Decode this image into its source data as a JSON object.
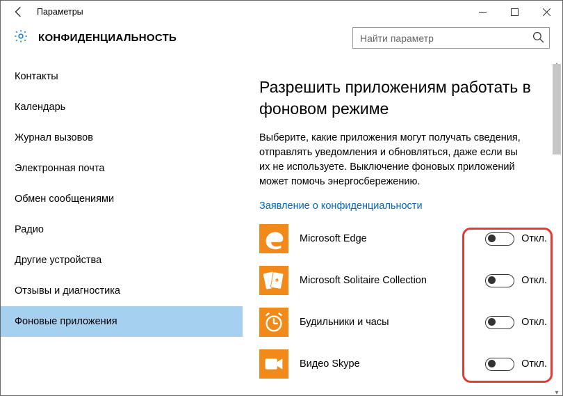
{
  "titlebar": {
    "back": "←",
    "title": "Параметры"
  },
  "header": {
    "title": "КОНФИДЕНЦИАЛЬНОСТЬ",
    "search_placeholder": "Найти параметр"
  },
  "sidebar": {
    "items": [
      {
        "label": "Контакты"
      },
      {
        "label": "Календарь"
      },
      {
        "label": "Журнал вызовов"
      },
      {
        "label": "Электронная почта"
      },
      {
        "label": "Обмен сообщениями"
      },
      {
        "label": "Радио"
      },
      {
        "label": "Другие устройства"
      },
      {
        "label": "Отзывы и диагностика"
      },
      {
        "label": "Фоновые приложения",
        "selected": true
      }
    ]
  },
  "main": {
    "title": "Разрешить приложениям работать в фоновом режиме",
    "description": "Выберите, какие приложения могут получать сведения, отправлять уведомления и обновляться, даже если вы их не используете. Выключение фоновых приложений может помочь энергосбережению.",
    "privacy_link": "Заявление о конфиденциальности",
    "apps": [
      {
        "name": "Microsoft Edge",
        "state": "Откл.",
        "icon": "edge"
      },
      {
        "name": "Microsoft Solitaire Collection",
        "state": "Откл.",
        "icon": "solitaire"
      },
      {
        "name": "Будильники и часы",
        "state": "Откл.",
        "icon": "alarm"
      },
      {
        "name": "Видео Skype",
        "state": "Откл.",
        "icon": "video"
      }
    ]
  }
}
